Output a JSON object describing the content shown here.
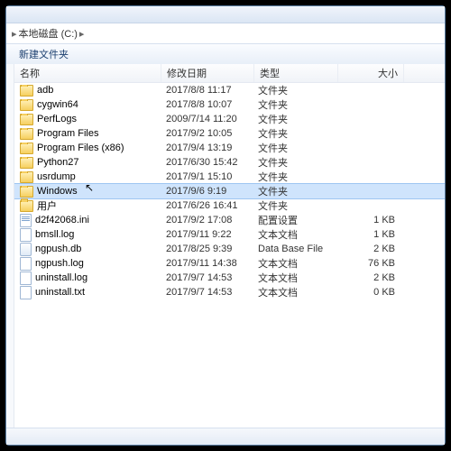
{
  "breadcrumb": {
    "segment": "本地磁盘 (C:)",
    "arrow": "▸"
  },
  "toolbar": {
    "new_folder": "新建文件夹"
  },
  "columns": {
    "name": "名称",
    "date": "修改日期",
    "type": "类型",
    "size": "大小"
  },
  "cursor_glyph": "↖",
  "items": [
    {
      "name": "adb",
      "date": "2017/8/8 11:17",
      "type": "文件夹",
      "size": "",
      "icon": "folder",
      "sel": false
    },
    {
      "name": "cygwin64",
      "date": "2017/8/8 10:07",
      "type": "文件夹",
      "size": "",
      "icon": "folder",
      "sel": false
    },
    {
      "name": "PerfLogs",
      "date": "2009/7/14 11:20",
      "type": "文件夹",
      "size": "",
      "icon": "folder",
      "sel": false
    },
    {
      "name": "Program Files",
      "date": "2017/9/2 10:05",
      "type": "文件夹",
      "size": "",
      "icon": "folder",
      "sel": false
    },
    {
      "name": "Program Files (x86)",
      "date": "2017/9/4 13:19",
      "type": "文件夹",
      "size": "",
      "icon": "folder",
      "sel": false
    },
    {
      "name": "Python27",
      "date": "2017/6/30 15:42",
      "type": "文件夹",
      "size": "",
      "icon": "folder",
      "sel": false
    },
    {
      "name": "usrdump",
      "date": "2017/9/1 15:10",
      "type": "文件夹",
      "size": "",
      "icon": "folder",
      "sel": false
    },
    {
      "name": "Windows",
      "date": "2017/9/6 9:19",
      "type": "文件夹",
      "size": "",
      "icon": "folder",
      "sel": true
    },
    {
      "name": "用户",
      "date": "2017/6/26 16:41",
      "type": "文件夹",
      "size": "",
      "icon": "folder",
      "sel": false
    },
    {
      "name": "d2f42068.ini",
      "date": "2017/9/2 17:08",
      "type": "配置设置",
      "size": "1 KB",
      "icon": "ini",
      "sel": false
    },
    {
      "name": "bmsll.log",
      "date": "2017/9/11 9:22",
      "type": "文本文档",
      "size": "1 KB",
      "icon": "file",
      "sel": false
    },
    {
      "name": "ngpush.db",
      "date": "2017/8/25 9:39",
      "type": "Data Base File",
      "size": "2 KB",
      "icon": "db",
      "sel": false
    },
    {
      "name": "ngpush.log",
      "date": "2017/9/11 14:38",
      "type": "文本文档",
      "size": "76 KB",
      "icon": "file",
      "sel": false
    },
    {
      "name": "uninstall.log",
      "date": "2017/9/7 14:53",
      "type": "文本文档",
      "size": "2 KB",
      "icon": "file",
      "sel": false
    },
    {
      "name": "uninstall.txt",
      "date": "2017/9/7 14:53",
      "type": "文本文档",
      "size": "0 KB",
      "icon": "file",
      "sel": false
    }
  ]
}
